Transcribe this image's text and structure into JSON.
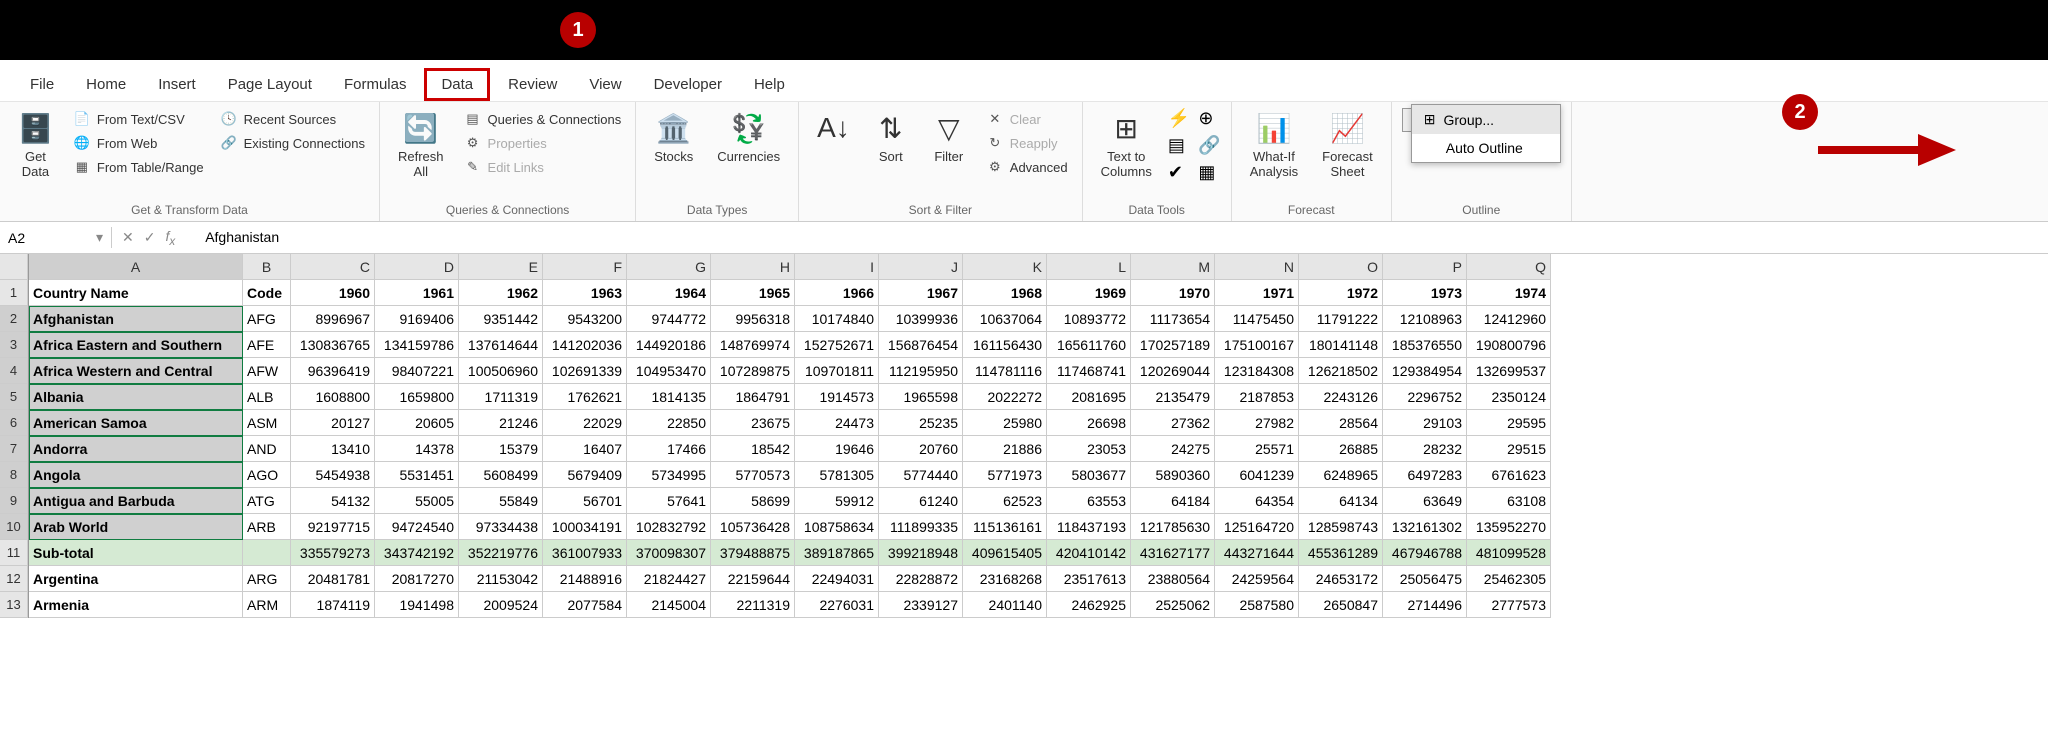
{
  "tabs": [
    "File",
    "Home",
    "Insert",
    "Page Layout",
    "Formulas",
    "Data",
    "Review",
    "View",
    "Developer",
    "Help"
  ],
  "active_tab": "Data",
  "ribbon": {
    "get_data": {
      "label": "Get & Transform Data",
      "get_data": "Get\nData",
      "from_text": "From Text/CSV",
      "from_web": "From Web",
      "from_table": "From Table/Range",
      "recent": "Recent Sources",
      "existing": "Existing Connections"
    },
    "queries": {
      "label": "Queries & Connections",
      "refresh": "Refresh\nAll",
      "qc": "Queries & Connections",
      "props": "Properties",
      "edit": "Edit Links"
    },
    "datatypes": {
      "label": "Data Types",
      "stocks": "Stocks",
      "currencies": "Currencies"
    },
    "sortfilter": {
      "label": "Sort & Filter",
      "sort": "Sort",
      "filter": "Filter",
      "clear": "Clear",
      "reapply": "Reapply",
      "advanced": "Advanced"
    },
    "datatools": {
      "label": "Data Tools",
      "ttc": "Text to\nColumns"
    },
    "forecast": {
      "label": "Forecast",
      "wia": "What-If\nAnalysis",
      "fs": "Forecast\nSheet"
    },
    "outline": {
      "label": "Outline",
      "group": "Group",
      "dd_group": "Group...",
      "dd_auto": "Auto Outline"
    }
  },
  "namebox": "A2",
  "formula_value": "Afghanistan",
  "columns": [
    "A",
    "B",
    "C",
    "D",
    "E",
    "F",
    "G",
    "H",
    "I",
    "J",
    "K",
    "L",
    "M",
    "N",
    "O",
    "P",
    "Q"
  ],
  "year_headers": [
    "1960",
    "1961",
    "1962",
    "1963",
    "1964",
    "1965",
    "1966",
    "1967",
    "1968",
    "1969",
    "1970",
    "1971",
    "1972",
    "1973",
    "1974"
  ],
  "header_row": {
    "a": "Country Name",
    "b": "Code"
  },
  "rows": [
    {
      "n": 2,
      "a": "Afghanistan",
      "b": "AFG",
      "y": [
        "8996967",
        "9169406",
        "9351442",
        "9543200",
        "9744772",
        "9956318",
        "10174840",
        "10399936",
        "10637064",
        "10893772",
        "11173654",
        "11475450",
        "11791222",
        "12108963",
        "12412960"
      ]
    },
    {
      "n": 3,
      "a": "Africa Eastern and Southern",
      "b": "AFE",
      "y": [
        "130836765",
        "134159786",
        "137614644",
        "141202036",
        "144920186",
        "148769974",
        "152752671",
        "156876454",
        "161156430",
        "165611760",
        "170257189",
        "175100167",
        "180141148",
        "185376550",
        "190800796"
      ]
    },
    {
      "n": 4,
      "a": "Africa Western and Central",
      "b": "AFW",
      "y": [
        "96396419",
        "98407221",
        "100506960",
        "102691339",
        "104953470",
        "107289875",
        "109701811",
        "112195950",
        "114781116",
        "117468741",
        "120269044",
        "123184308",
        "126218502",
        "129384954",
        "132699537"
      ]
    },
    {
      "n": 5,
      "a": "Albania",
      "b": "ALB",
      "y": [
        "1608800",
        "1659800",
        "1711319",
        "1762621",
        "1814135",
        "1864791",
        "1914573",
        "1965598",
        "2022272",
        "2081695",
        "2135479",
        "2187853",
        "2243126",
        "2296752",
        "2350124"
      ]
    },
    {
      "n": 6,
      "a": "American Samoa",
      "b": "ASM",
      "y": [
        "20127",
        "20605",
        "21246",
        "22029",
        "22850",
        "23675",
        "24473",
        "25235",
        "25980",
        "26698",
        "27362",
        "27982",
        "28564",
        "29103",
        "29595"
      ]
    },
    {
      "n": 7,
      "a": "Andorra",
      "b": "AND",
      "y": [
        "13410",
        "14378",
        "15379",
        "16407",
        "17466",
        "18542",
        "19646",
        "20760",
        "21886",
        "23053",
        "24275",
        "25571",
        "26885",
        "28232",
        "29515"
      ]
    },
    {
      "n": 8,
      "a": "Angola",
      "b": "AGO",
      "y": [
        "5454938",
        "5531451",
        "5608499",
        "5679409",
        "5734995",
        "5770573",
        "5781305",
        "5774440",
        "5771973",
        "5803677",
        "5890360",
        "6041239",
        "6248965",
        "6497283",
        "6761623"
      ]
    },
    {
      "n": 9,
      "a": "Antigua and Barbuda",
      "b": "ATG",
      "y": [
        "54132",
        "55005",
        "55849",
        "56701",
        "57641",
        "58699",
        "59912",
        "61240",
        "62523",
        "63553",
        "64184",
        "64354",
        "64134",
        "63649",
        "63108"
      ]
    },
    {
      "n": 10,
      "a": "Arab World",
      "b": "ARB",
      "y": [
        "92197715",
        "94724540",
        "97334438",
        "100034191",
        "102832792",
        "105736428",
        "108758634",
        "111899335",
        "115136161",
        "118437193",
        "121785630",
        "125164720",
        "128598743",
        "132161302",
        "135952270"
      ]
    }
  ],
  "subtotal": {
    "n": 11,
    "a": "Sub-total",
    "y": [
      "335579273",
      "343742192",
      "352219776",
      "361007933",
      "370098307",
      "379488875",
      "389187865",
      "399218948",
      "409615405",
      "420410142",
      "431627177",
      "443271644",
      "455361289",
      "467946788",
      "481099528"
    ]
  },
  "after_rows": [
    {
      "n": 12,
      "a": "Argentina",
      "b": "ARG",
      "y": [
        "20481781",
        "20817270",
        "21153042",
        "21488916",
        "21824427",
        "22159644",
        "22494031",
        "22828872",
        "23168268",
        "23517613",
        "23880564",
        "24259564",
        "24653172",
        "25056475",
        "25462305"
      ]
    },
    {
      "n": 13,
      "a": "Armenia",
      "b": "ARM",
      "y": [
        "1874119",
        "1941498",
        "2009524",
        "2077584",
        "2145004",
        "2211319",
        "2276031",
        "2339127",
        "2401140",
        "2462925",
        "2525062",
        "2587580",
        "2650847",
        "2714496",
        "2777573"
      ]
    }
  ],
  "badges": {
    "one": "1",
    "two": "2"
  },
  "chart_data": {
    "type": "table",
    "columns": [
      "Country Name",
      "Code",
      "1960",
      "1961",
      "1962",
      "1963",
      "1964",
      "1965",
      "1966",
      "1967",
      "1968",
      "1969",
      "1970",
      "1971",
      "1972",
      "1973",
      "1974"
    ],
    "rows": [
      [
        "Afghanistan",
        "AFG",
        8996967,
        9169406,
        9351442,
        9543200,
        9744772,
        9956318,
        10174840,
        10399936,
        10637064,
        10893772,
        11173654,
        11475450,
        11791222,
        12108963,
        12412960
      ],
      [
        "Africa Eastern and Southern",
        "AFE",
        130836765,
        134159786,
        137614644,
        141202036,
        144920186,
        148769974,
        152752671,
        156876454,
        161156430,
        165611760,
        170257189,
        175100167,
        180141148,
        185376550,
        190800796
      ],
      [
        "Africa Western and Central",
        "AFW",
        96396419,
        98407221,
        100506960,
        102691339,
        104953470,
        107289875,
        109701811,
        112195950,
        114781116,
        117468741,
        120269044,
        123184308,
        126218502,
        129384954,
        132699537
      ],
      [
        "Albania",
        "ALB",
        1608800,
        1659800,
        1711319,
        1762621,
        1814135,
        1864791,
        1914573,
        1965598,
        2022272,
        2081695,
        2135479,
        2187853,
        2243126,
        2296752,
        2350124
      ],
      [
        "American Samoa",
        "ASM",
        20127,
        20605,
        21246,
        22029,
        22850,
        23675,
        24473,
        25235,
        25980,
        26698,
        27362,
        27982,
        28564,
        29103,
        29595
      ],
      [
        "Andorra",
        "AND",
        13410,
        14378,
        15379,
        16407,
        17466,
        18542,
        19646,
        20760,
        21886,
        23053,
        24275,
        25571,
        26885,
        28232,
        29515
      ],
      [
        "Angola",
        "AGO",
        5454938,
        5531451,
        5608499,
        5679409,
        5734995,
        5770573,
        5781305,
        5774440,
        5771973,
        5803677,
        5890360,
        6041239,
        6248965,
        6497283,
        6761623
      ],
      [
        "Antigua and Barbuda",
        "ATG",
        54132,
        55005,
        55849,
        56701,
        57641,
        58699,
        59912,
        61240,
        62523,
        63553,
        64184,
        64354,
        64134,
        63649,
        63108
      ],
      [
        "Arab World",
        "ARB",
        92197715,
        94724540,
        97334438,
        100034191,
        102832792,
        105736428,
        108758634,
        111899335,
        115136161,
        118437193,
        121785630,
        125164720,
        128598743,
        132161302,
        135952270
      ],
      [
        "Sub-total",
        "",
        335579273,
        343742192,
        352219776,
        361007933,
        370098307,
        379488875,
        389187865,
        399218948,
        409615405,
        420410142,
        431627177,
        443271644,
        455361289,
        467946788,
        481099528
      ],
      [
        "Argentina",
        "ARG",
        20481781,
        20817270,
        21153042,
        21488916,
        21824427,
        22159644,
        22494031,
        22828872,
        23168268,
        23517613,
        23880564,
        24259564,
        24653172,
        25056475,
        25462305
      ],
      [
        "Armenia",
        "ARM",
        1874119,
        1941498,
        2009524,
        2077584,
        2145004,
        2211319,
        2276031,
        2339127,
        2401140,
        2462925,
        2525062,
        2587580,
        2650847,
        2714496,
        2777573
      ]
    ]
  }
}
